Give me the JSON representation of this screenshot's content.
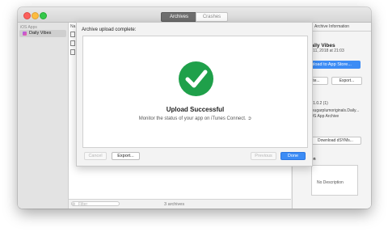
{
  "window": {
    "tabs": [
      {
        "label": "Archives",
        "selected": true
      },
      {
        "label": "Crashes",
        "selected": false
      }
    ]
  },
  "sidebar": {
    "header": "iOS Apps",
    "items": [
      {
        "label": "Daily Vibes",
        "selected": true
      }
    ]
  },
  "list": {
    "column_header": "Na",
    "filter_placeholder": "Filter",
    "archive_count": "3 archives"
  },
  "inspector": {
    "title": "Archive Information",
    "app_name": "Daily Vibes",
    "date": "n 11, 2018 at 21:03",
    "upload_button": "pload to App Store...",
    "validate_button": "ate...",
    "export_button": "Export...",
    "version": "n 1.0.2 (1)",
    "identifier": "r sugarplumoriginals.Daily...",
    "type": "iOS App Archive",
    "dsym_button": "Download dSYMs...",
    "description_heading": "ion",
    "description_placeholder": "No Description"
  },
  "sheet": {
    "heading": "Archive upload complete:",
    "title": "Upload Successful",
    "subtitle": "Monitor the status of your app on iTunes Connect.",
    "cancel_button": "Cancel",
    "export_button": "Export...",
    "previous_button": "Previous",
    "done_button": "Done"
  },
  "colors": {
    "success": "#1fa04a",
    "accent": "#3c8cf5"
  }
}
